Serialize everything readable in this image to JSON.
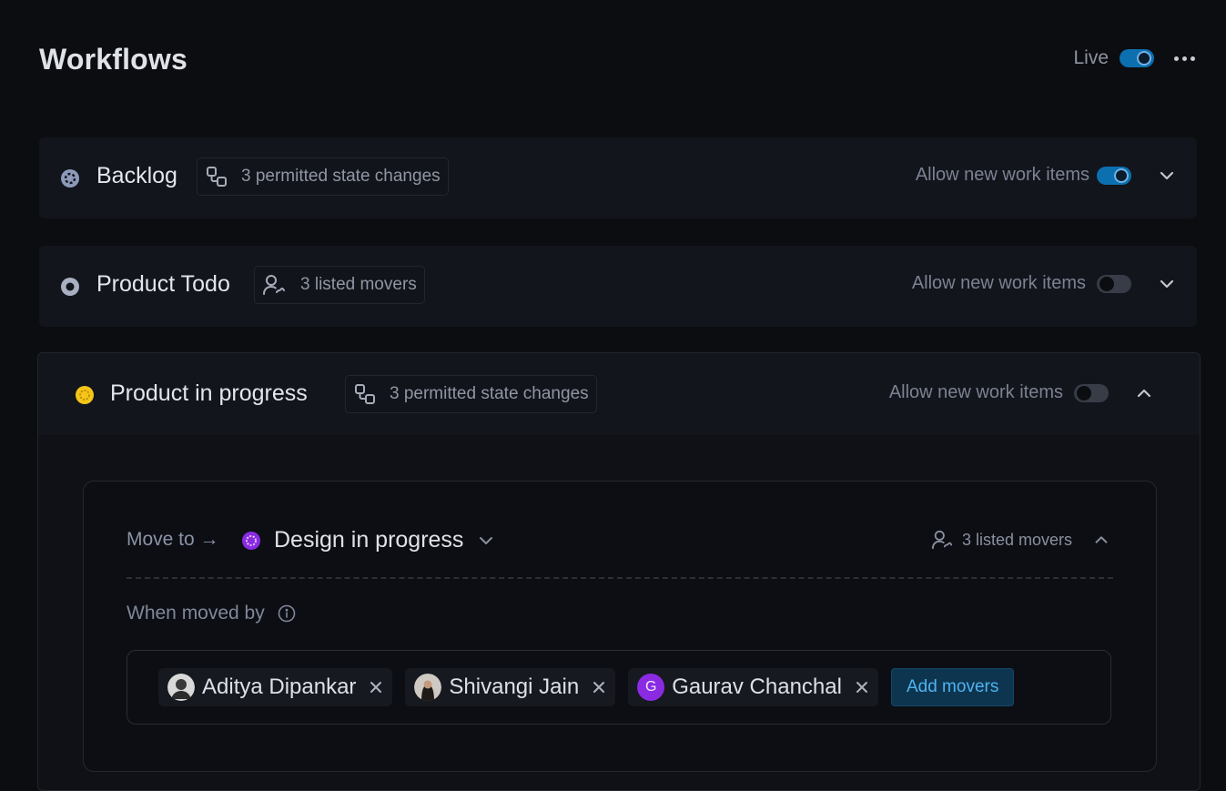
{
  "header": {
    "title": "Workflows",
    "live_label": "Live",
    "live_enabled": true
  },
  "states": [
    {
      "name": "Backlog",
      "chip_label": "3 permitted state changes",
      "chip_icon": "state-changes-icon",
      "allow_label": "Allow new work items",
      "allow_enabled": true,
      "expanded": false,
      "status_icon": "backlog-icon"
    },
    {
      "name": "Product Todo",
      "chip_label": "3 listed movers",
      "chip_icon": "movers-icon",
      "allow_label": "Allow new work items",
      "allow_enabled": false,
      "expanded": false,
      "status_icon": "todo-icon"
    },
    {
      "name": "Product in progress",
      "chip_label": "3 permitted state changes",
      "chip_icon": "state-changes-icon",
      "allow_label": "Allow new work items",
      "allow_enabled": false,
      "expanded": true,
      "status_icon": "in-progress-icon"
    }
  ],
  "transition": {
    "move_to_label": "Move to →",
    "target_state": "Design in progress",
    "movers_summary": "3 listed movers",
    "when_moved_by_label": "When moved by",
    "movers": [
      {
        "name": "Aditya Dipankar",
        "avatar": "photo"
      },
      {
        "name": "Shivangi Jain",
        "avatar": "photo"
      },
      {
        "name": "Gaurav Chanchal",
        "avatar_letter": "G"
      }
    ],
    "add_movers_label": "Add movers"
  },
  "colors": {
    "accent": "#0c6fb0",
    "in_progress": "#f5c518",
    "design_state": "#8a2be2",
    "backlog": "#8d9ab8"
  }
}
